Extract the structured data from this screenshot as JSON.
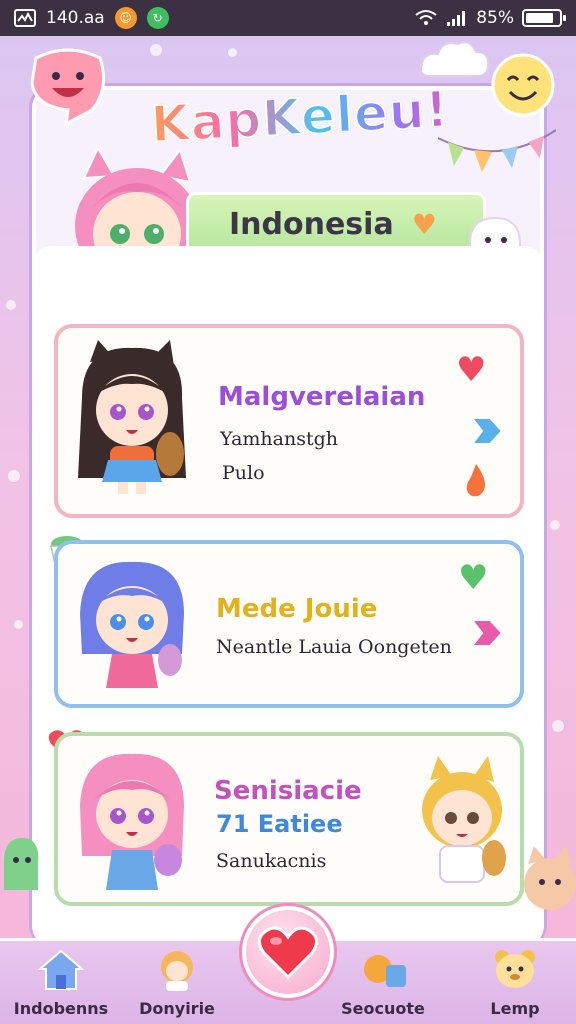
{
  "status_bar": {
    "time": "140.aa",
    "battery": "85%",
    "battery_level": 0.85,
    "app_chip_1_color": "#f59a2e",
    "app_chip_2_color": "#3fbf5f"
  },
  "app": {
    "title": "KapKeleu!",
    "banner": "Indonesia"
  },
  "cards": [
    {
      "name": "Malgverelaian",
      "name_color": "#9b4fd6",
      "line1": "Yamhanstgh",
      "line2": "Pulo",
      "border_color": "#f3b4c4",
      "icons": [
        "heart-icon",
        "arrow-right-icon",
        "flame-icon"
      ]
    },
    {
      "name": "Mede Jouie",
      "name_color": "#e2b21a",
      "line1": "Neantle Lauia Oongeten",
      "border_color": "#8fc0ef",
      "icons": [
        "heart-icon",
        "arrow-right-icon"
      ]
    },
    {
      "name": "Senisiacie",
      "name_color": "#c54fbf",
      "subtitle": "71 Eatiee",
      "subtitle_color": "#3f89dc",
      "line1": "Sanukacnis",
      "border_color": "#b9dcae"
    }
  ],
  "nav": {
    "items": [
      {
        "label": "Indobenns",
        "icon": "home-icon"
      },
      {
        "label": "Donyirie",
        "icon": "character-icon"
      },
      {
        "label": "Seocuote",
        "icon": "pets-icon"
      },
      {
        "label": "Lemp",
        "icon": "bear-icon"
      }
    ],
    "center_icon": "heart-icon"
  }
}
